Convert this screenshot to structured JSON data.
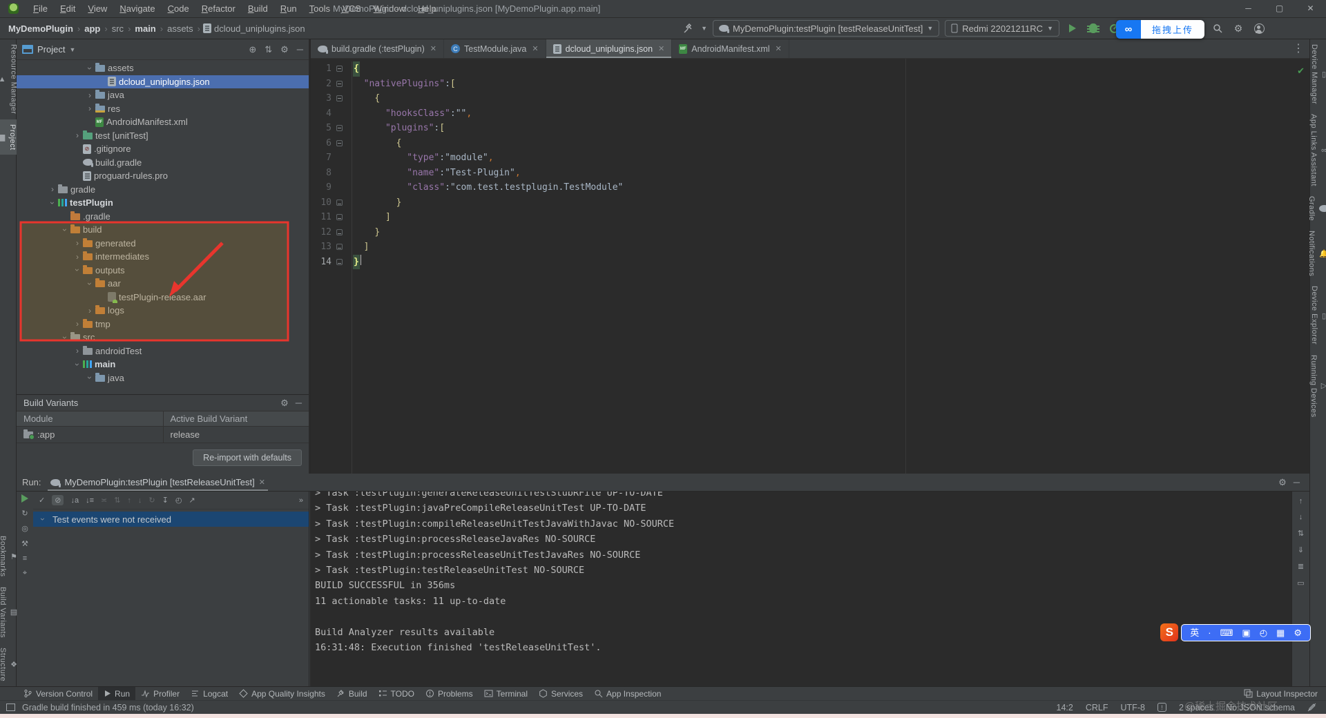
{
  "app": {
    "menus": [
      "File",
      "Edit",
      "View",
      "Navigate",
      "Code",
      "Refactor",
      "Build",
      "Run",
      "Tools",
      "VCS",
      "Window",
      "Help"
    ],
    "title": "MyDemoPlugin - dcloud_uniplugins.json [MyDemoPlugin.app.main]",
    "window_controls": [
      "minimize",
      "maximize",
      "close"
    ]
  },
  "toolbar": {
    "breadcrumbs": [
      {
        "label": "MyDemoPlugin",
        "bold": true
      },
      {
        "label": "app",
        "bold": true
      },
      {
        "label": "src",
        "bold": false
      },
      {
        "label": "main",
        "bold": true
      },
      {
        "label": "assets",
        "bold": false
      },
      {
        "label": "dcloud_uniplugins.json",
        "bold": false,
        "icon": "file-json"
      }
    ],
    "run_config": "MyDemoPlugin:testPlugin [testReleaseUnitTest]",
    "device": "Redmi 22021211RC",
    "netdisk": {
      "logo": "baidu-netdisk",
      "label": "拖拽上传",
      "accent": "#1777F2"
    }
  },
  "left_strip": {
    "top": [
      {
        "label": "Resource Manager",
        "icon": "resource-manager",
        "active": false
      },
      {
        "label": "Project",
        "icon": "project-folder",
        "active": true
      }
    ],
    "bottom": [
      {
        "label": "Bookmarks",
        "icon": "bookmark"
      },
      {
        "label": "Build Variants",
        "icon": "variants"
      },
      {
        "label": "Structure",
        "icon": "structure"
      }
    ]
  },
  "project_panel": {
    "title": "Project",
    "header_icons": [
      "locate",
      "collapse-all",
      "settings",
      "hide"
    ],
    "tree": [
      {
        "label": "assets",
        "level": 5,
        "state": "open",
        "icon": "folder-blue"
      },
      {
        "label": "dcloud_uniplugins.json",
        "level": 6,
        "state": "none",
        "icon": "file-json",
        "selected": true
      },
      {
        "label": "java",
        "level": 5,
        "state": "closed",
        "icon": "folder-blue"
      },
      {
        "label": "res",
        "level": 5,
        "state": "closed",
        "icon": "folder-res"
      },
      {
        "label": "AndroidManifest.xml",
        "level": 5,
        "state": "none",
        "icon": "file-manifest"
      },
      {
        "label": "test [unitTest]",
        "level": 4,
        "state": "closed",
        "icon": "folder-test"
      },
      {
        "label": ".gitignore",
        "level": 4,
        "state": "none",
        "icon": "file-git"
      },
      {
        "label": "build.gradle",
        "level": 4,
        "state": "none",
        "icon": "gradle-elephant"
      },
      {
        "label": "proguard-rules.pro",
        "level": 4,
        "state": "none",
        "icon": "file-pro"
      },
      {
        "label": "gradle",
        "level": 2,
        "state": "closed",
        "icon": "folder-grey"
      },
      {
        "label": "testPlugin",
        "level": 2,
        "state": "open",
        "icon": "module",
        "bold": true
      },
      {
        "label": ".gradle",
        "level": 3,
        "state": "none",
        "icon": "folder-orange"
      },
      {
        "label": "build",
        "level": 3,
        "state": "open",
        "icon": "folder-orange",
        "boxed": true
      },
      {
        "label": "generated",
        "level": 4,
        "state": "closed",
        "icon": "folder-orange",
        "boxed": true
      },
      {
        "label": "intermediates",
        "level": 4,
        "state": "closed",
        "icon": "folder-orange",
        "boxed": true
      },
      {
        "label": "outputs",
        "level": 4,
        "state": "open",
        "icon": "folder-orange",
        "boxed": true
      },
      {
        "label": "aar",
        "level": 5,
        "state": "open",
        "icon": "folder-orange",
        "boxed": true
      },
      {
        "label": "testPlugin-release.aar",
        "level": 6,
        "state": "none",
        "icon": "file-aar",
        "boxed": true
      },
      {
        "label": "logs",
        "level": 5,
        "state": "closed",
        "icon": "folder-orange",
        "boxed": true
      },
      {
        "label": "tmp",
        "level": 4,
        "state": "closed",
        "icon": "folder-orange",
        "boxed": true
      },
      {
        "label": "src",
        "level": 3,
        "state": "open",
        "icon": "folder-grey"
      },
      {
        "label": "androidTest",
        "level": 4,
        "state": "closed",
        "icon": "folder-grey"
      },
      {
        "label": "main",
        "level": 4,
        "state": "open",
        "icon": "module",
        "bold": true
      },
      {
        "label": "java",
        "level": 5,
        "state": "open",
        "icon": "folder-blue"
      }
    ]
  },
  "build_variants_panel": {
    "title": "Build Variants",
    "header_icons": [
      "settings",
      "hide"
    ],
    "columns": [
      "Module",
      "Active Build Variant"
    ],
    "rows": [
      {
        "module": ":app",
        "variant": "release",
        "icon": "module-folder"
      }
    ],
    "button": "Re-import with defaults"
  },
  "editor": {
    "tabs": [
      {
        "label": "build.gradle (:testPlugin)",
        "icon": "gradle-elephant",
        "active": false
      },
      {
        "label": "TestModule.java",
        "icon": "java-class",
        "active": false
      },
      {
        "label": "dcloud_uniplugins.json",
        "icon": "file-json",
        "active": true
      },
      {
        "label": "AndroidManifest.xml",
        "icon": "file-manifest",
        "active": false
      }
    ],
    "more_icon": "⋮",
    "inspection_ok_icon": "✔",
    "lines": [
      {
        "n": 1,
        "fold": "start",
        "tokens": [
          {
            "t": "{",
            "c": "hl"
          }
        ]
      },
      {
        "n": 2,
        "fold": "start",
        "tokens": [
          {
            "t": "  "
          },
          {
            "t": "\"nativePlugins\"",
            "c": "key"
          },
          {
            "t": ":",
            "c": "p"
          },
          {
            "t": "[",
            "c": "br"
          }
        ]
      },
      {
        "n": 3,
        "fold": "start",
        "tokens": [
          {
            "t": "    "
          },
          {
            "t": "{",
            "c": "br"
          }
        ]
      },
      {
        "n": 4,
        "fold": "",
        "tokens": [
          {
            "t": "      "
          },
          {
            "t": "\"hooksClass\"",
            "c": "key"
          },
          {
            "t": ":",
            "c": "p"
          },
          {
            "t": "\"\"",
            "c": "str"
          },
          {
            "t": ",",
            "c": "com"
          }
        ]
      },
      {
        "n": 5,
        "fold": "start",
        "tokens": [
          {
            "t": "      "
          },
          {
            "t": "\"plugins\"",
            "c": "key"
          },
          {
            "t": ":",
            "c": "p"
          },
          {
            "t": "[",
            "c": "br"
          }
        ]
      },
      {
        "n": 6,
        "fold": "start",
        "tokens": [
          {
            "t": "        "
          },
          {
            "t": "{",
            "c": "br"
          }
        ]
      },
      {
        "n": 7,
        "fold": "",
        "tokens": [
          {
            "t": "          "
          },
          {
            "t": "\"type\"",
            "c": "key"
          },
          {
            "t": ":",
            "c": "p"
          },
          {
            "t": "\"module\"",
            "c": "str"
          },
          {
            "t": ",",
            "c": "com"
          }
        ]
      },
      {
        "n": 8,
        "fold": "",
        "tokens": [
          {
            "t": "          "
          },
          {
            "t": "\"name\"",
            "c": "key"
          },
          {
            "t": ":",
            "c": "p"
          },
          {
            "t": "\"Test-Plugin\"",
            "c": "str"
          },
          {
            "t": ",",
            "c": "com"
          }
        ]
      },
      {
        "n": 9,
        "fold": "",
        "tokens": [
          {
            "t": "          "
          },
          {
            "t": "\"class\"",
            "c": "key"
          },
          {
            "t": ":",
            "c": "p"
          },
          {
            "t": "\"com.test.testplugin.TestModule\"",
            "c": "str"
          }
        ]
      },
      {
        "n": 10,
        "fold": "end",
        "tokens": [
          {
            "t": "        "
          },
          {
            "t": "}",
            "c": "br"
          }
        ]
      },
      {
        "n": 11,
        "fold": "end",
        "tokens": [
          {
            "t": "      "
          },
          {
            "t": "]",
            "c": "br"
          }
        ]
      },
      {
        "n": 12,
        "fold": "end",
        "tokens": [
          {
            "t": "    "
          },
          {
            "t": "}",
            "c": "br"
          }
        ]
      },
      {
        "n": 13,
        "fold": "end",
        "tokens": [
          {
            "t": "  "
          },
          {
            "t": "]",
            "c": "br"
          }
        ]
      },
      {
        "n": 14,
        "fold": "end",
        "caret": true,
        "tokens": [
          {
            "t": "}",
            "c": "hl"
          }
        ]
      }
    ]
  },
  "run_panel": {
    "label": "Run:",
    "tab": "MyDemoPlugin:testPlugin [testReleaseUnitTest]",
    "header_icons": [
      "settings",
      "hide"
    ],
    "left_icons": [
      "rerun-play",
      "rerun",
      "coverage",
      "wrench",
      "list",
      "pin"
    ],
    "test_toolbar_icons": [
      "passed",
      "ignored",
      "sort-alpha",
      "sort-duration",
      "expand-all",
      "collapse-all",
      "previous",
      "next",
      "rerun-failed",
      "import",
      "history",
      "export",
      "more"
    ],
    "message": "Test events were not received",
    "console_icons": [
      "up",
      "down",
      "sort",
      "scroll-end",
      "lines",
      "clear"
    ],
    "console": [
      "> Task :testPlugin:generateReleaseUnitTestStubRFile UP-TO-DATE",
      "> Task :testPlugin:javaPreCompileReleaseUnitTest UP-TO-DATE",
      "> Task :testPlugin:compileReleaseUnitTestJavaWithJavac NO-SOURCE",
      "> Task :testPlugin:processReleaseJavaRes NO-SOURCE",
      "> Task :testPlugin:processReleaseUnitTestJavaRes NO-SOURCE",
      "> Task :testPlugin:testReleaseUnitTest NO-SOURCE",
      "BUILD SUCCESSFUL in 356ms",
      "11 actionable tasks: 11 up-to-date",
      "",
      "Build Analyzer results available",
      "16:31:48: Execution finished 'testReleaseUnitTest'."
    ]
  },
  "bottom_bar": {
    "items": [
      {
        "label": "Version Control",
        "icon": "branch",
        "active": false
      },
      {
        "label": "Run",
        "icon": "play",
        "active": true
      },
      {
        "label": "Profiler",
        "icon": "profiler",
        "active": false
      },
      {
        "label": "Logcat",
        "icon": "logcat",
        "active": false
      },
      {
        "label": "App Quality Insights",
        "icon": "insights",
        "active": false
      },
      {
        "label": "Build",
        "icon": "hammer",
        "active": false
      },
      {
        "label": "TODO",
        "icon": "todo",
        "active": false
      },
      {
        "label": "Problems",
        "icon": "problems",
        "active": false
      },
      {
        "label": "Terminal",
        "icon": "terminal",
        "active": false
      },
      {
        "label": "Services",
        "icon": "services",
        "active": false
      },
      {
        "label": "App Inspection",
        "icon": "inspection",
        "active": false
      }
    ],
    "right": {
      "label": "Layout Inspector",
      "icon": "layout-inspector"
    }
  },
  "status_bar": {
    "message": "Gradle build finished in 459 ms (today 16:32)",
    "caret": "14:2",
    "line_separator": "CRLF",
    "encoding": "UTF-8",
    "indent": "2 spaces",
    "schema": "No JSON schema"
  },
  "right_strip": [
    {
      "label": "Device Manager",
      "icon": "phone"
    },
    {
      "label": "App Links Assistant",
      "icon": "link"
    },
    {
      "label": "Gradle",
      "icon": "gradle-elephant"
    },
    {
      "label": "Notifications",
      "icon": "bell"
    },
    {
      "label": "Device Explorer",
      "icon": "phone-search"
    },
    {
      "label": "Running Devices",
      "icon": "phone-play"
    }
  ],
  "overlays": {
    "watermark": "@稀土掘金技术社区",
    "ime": {
      "logo": "sogou-s",
      "lang": "英",
      "icons": [
        "dot",
        "keyboard",
        "clipboard",
        "clock",
        "grid",
        "settings"
      ]
    },
    "annotation": {
      "color": "#E8352D",
      "shape": "rectangle+arrow",
      "target": "build output folder with testPlugin-release.aar"
    }
  }
}
